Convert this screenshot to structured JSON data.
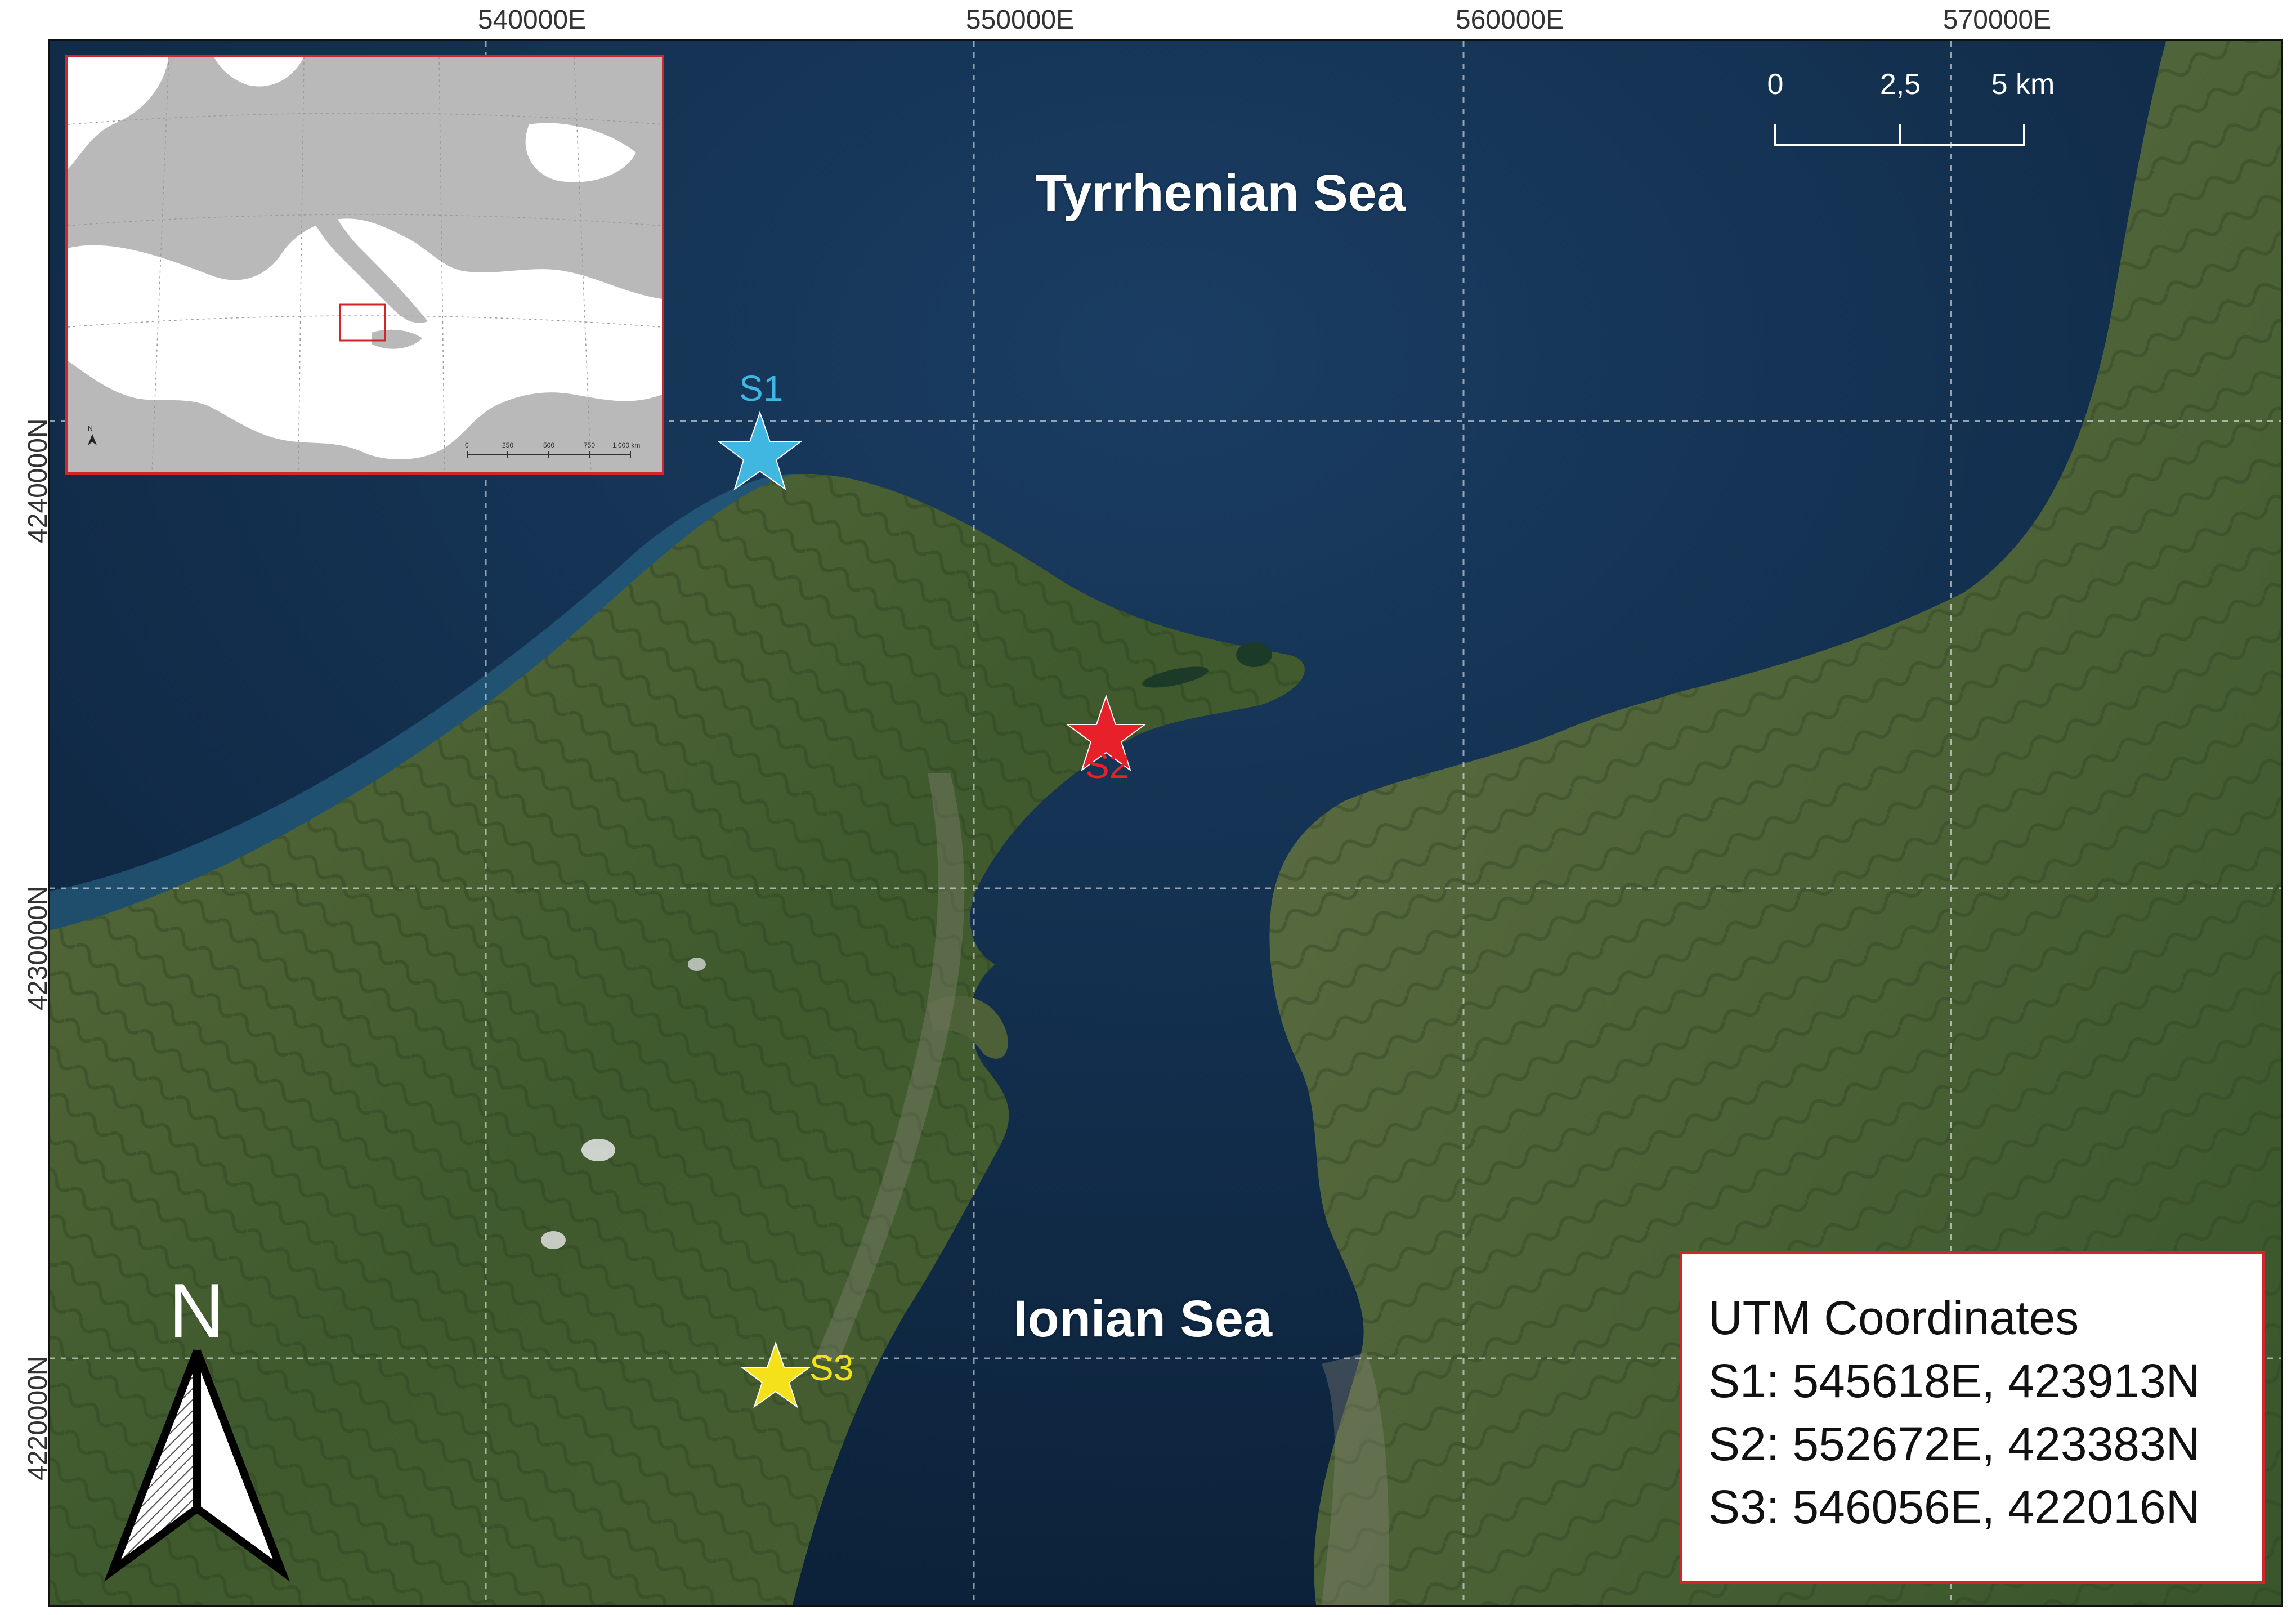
{
  "axes": {
    "easting_ticks": [
      "540000E",
      "550000E",
      "560000E",
      "570000E"
    ],
    "northing_ticks": [
      "4240000N",
      "4230000N",
      "4220000N"
    ]
  },
  "labels": {
    "tyrrhenian": "Tyrrhenian Sea",
    "ionian": "Ionian Sea"
  },
  "sites": [
    {
      "id": "S1",
      "color": "#3fb7e0"
    },
    {
      "id": "S2",
      "color": "#e8202a"
    },
    {
      "id": "S3",
      "color": "#f5e11a"
    }
  ],
  "scale_bar": {
    "labels": [
      "0",
      "2,5",
      "5 km"
    ]
  },
  "coordinates_box": {
    "title": "UTM Coordinates",
    "lines": [
      "S1: 545618E, 423913N",
      "S2: 552672E, 423383N",
      "S3: 546056E, 422016N"
    ]
  },
  "inset": {
    "north_label": "N",
    "scale_labels": [
      "0",
      "250",
      "500",
      "750",
      "1,000 km"
    ]
  },
  "north_arrow": {
    "label": "N"
  },
  "colors": {
    "frame_accent": "#d0262b",
    "sea": "#0f2a44",
    "land": "#4a5e33"
  }
}
